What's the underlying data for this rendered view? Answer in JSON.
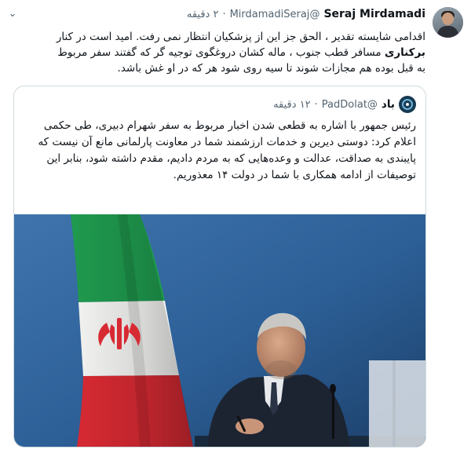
{
  "tweet": {
    "author_name": "Seraj Mirdamadi",
    "author_handle": "@MirdamadiSeraj",
    "separator": "·",
    "time": "۲ دقیقه",
    "more_icon": "chevron-down-icon",
    "text_line1": "اقدامی شایسته تقدیر ، الحق جز این از پزشکیان انتظار نمی رفت. امید است در کنار",
    "text_bold": "برکناری",
    "text_line2_rest": " مسافر قطب جنوب ، ماله کشان دروغگوی توجیه گر که گفتند سفر مربوط",
    "text_line3": "به قبل بوده هم مجازات شوند تا سیه روی شود هر که در او غش باشد."
  },
  "quoted_tweet": {
    "author_name": "باد",
    "author_handle": "@PadDolat",
    "separator": "·",
    "time": "۱۲ دقیقه",
    "text": "رئیس جمهور با اشاره به قطعی شدن اخبار مربوط به سفر شهرام دبیری، طی حکمی اعلام کرد: دوستی دیرین و خدمات ارزشمند شما در معاونت پارلمانی مانع آن نیست که پایبندی به صداقت، عدالت و وعده‌هایی که به مردم دادیم، مقدم داشته شود، بنابر این توصیفات از ادامه همکاری با شما در دولت ۱۴ معذوریم."
  },
  "colors": {
    "text": "#0f1419",
    "secondary": "#536471",
    "border": "#cfd9de",
    "flag_green": "#1f9a4e",
    "flag_red": "#d82a33",
    "background_blue": "#2c5f96"
  }
}
